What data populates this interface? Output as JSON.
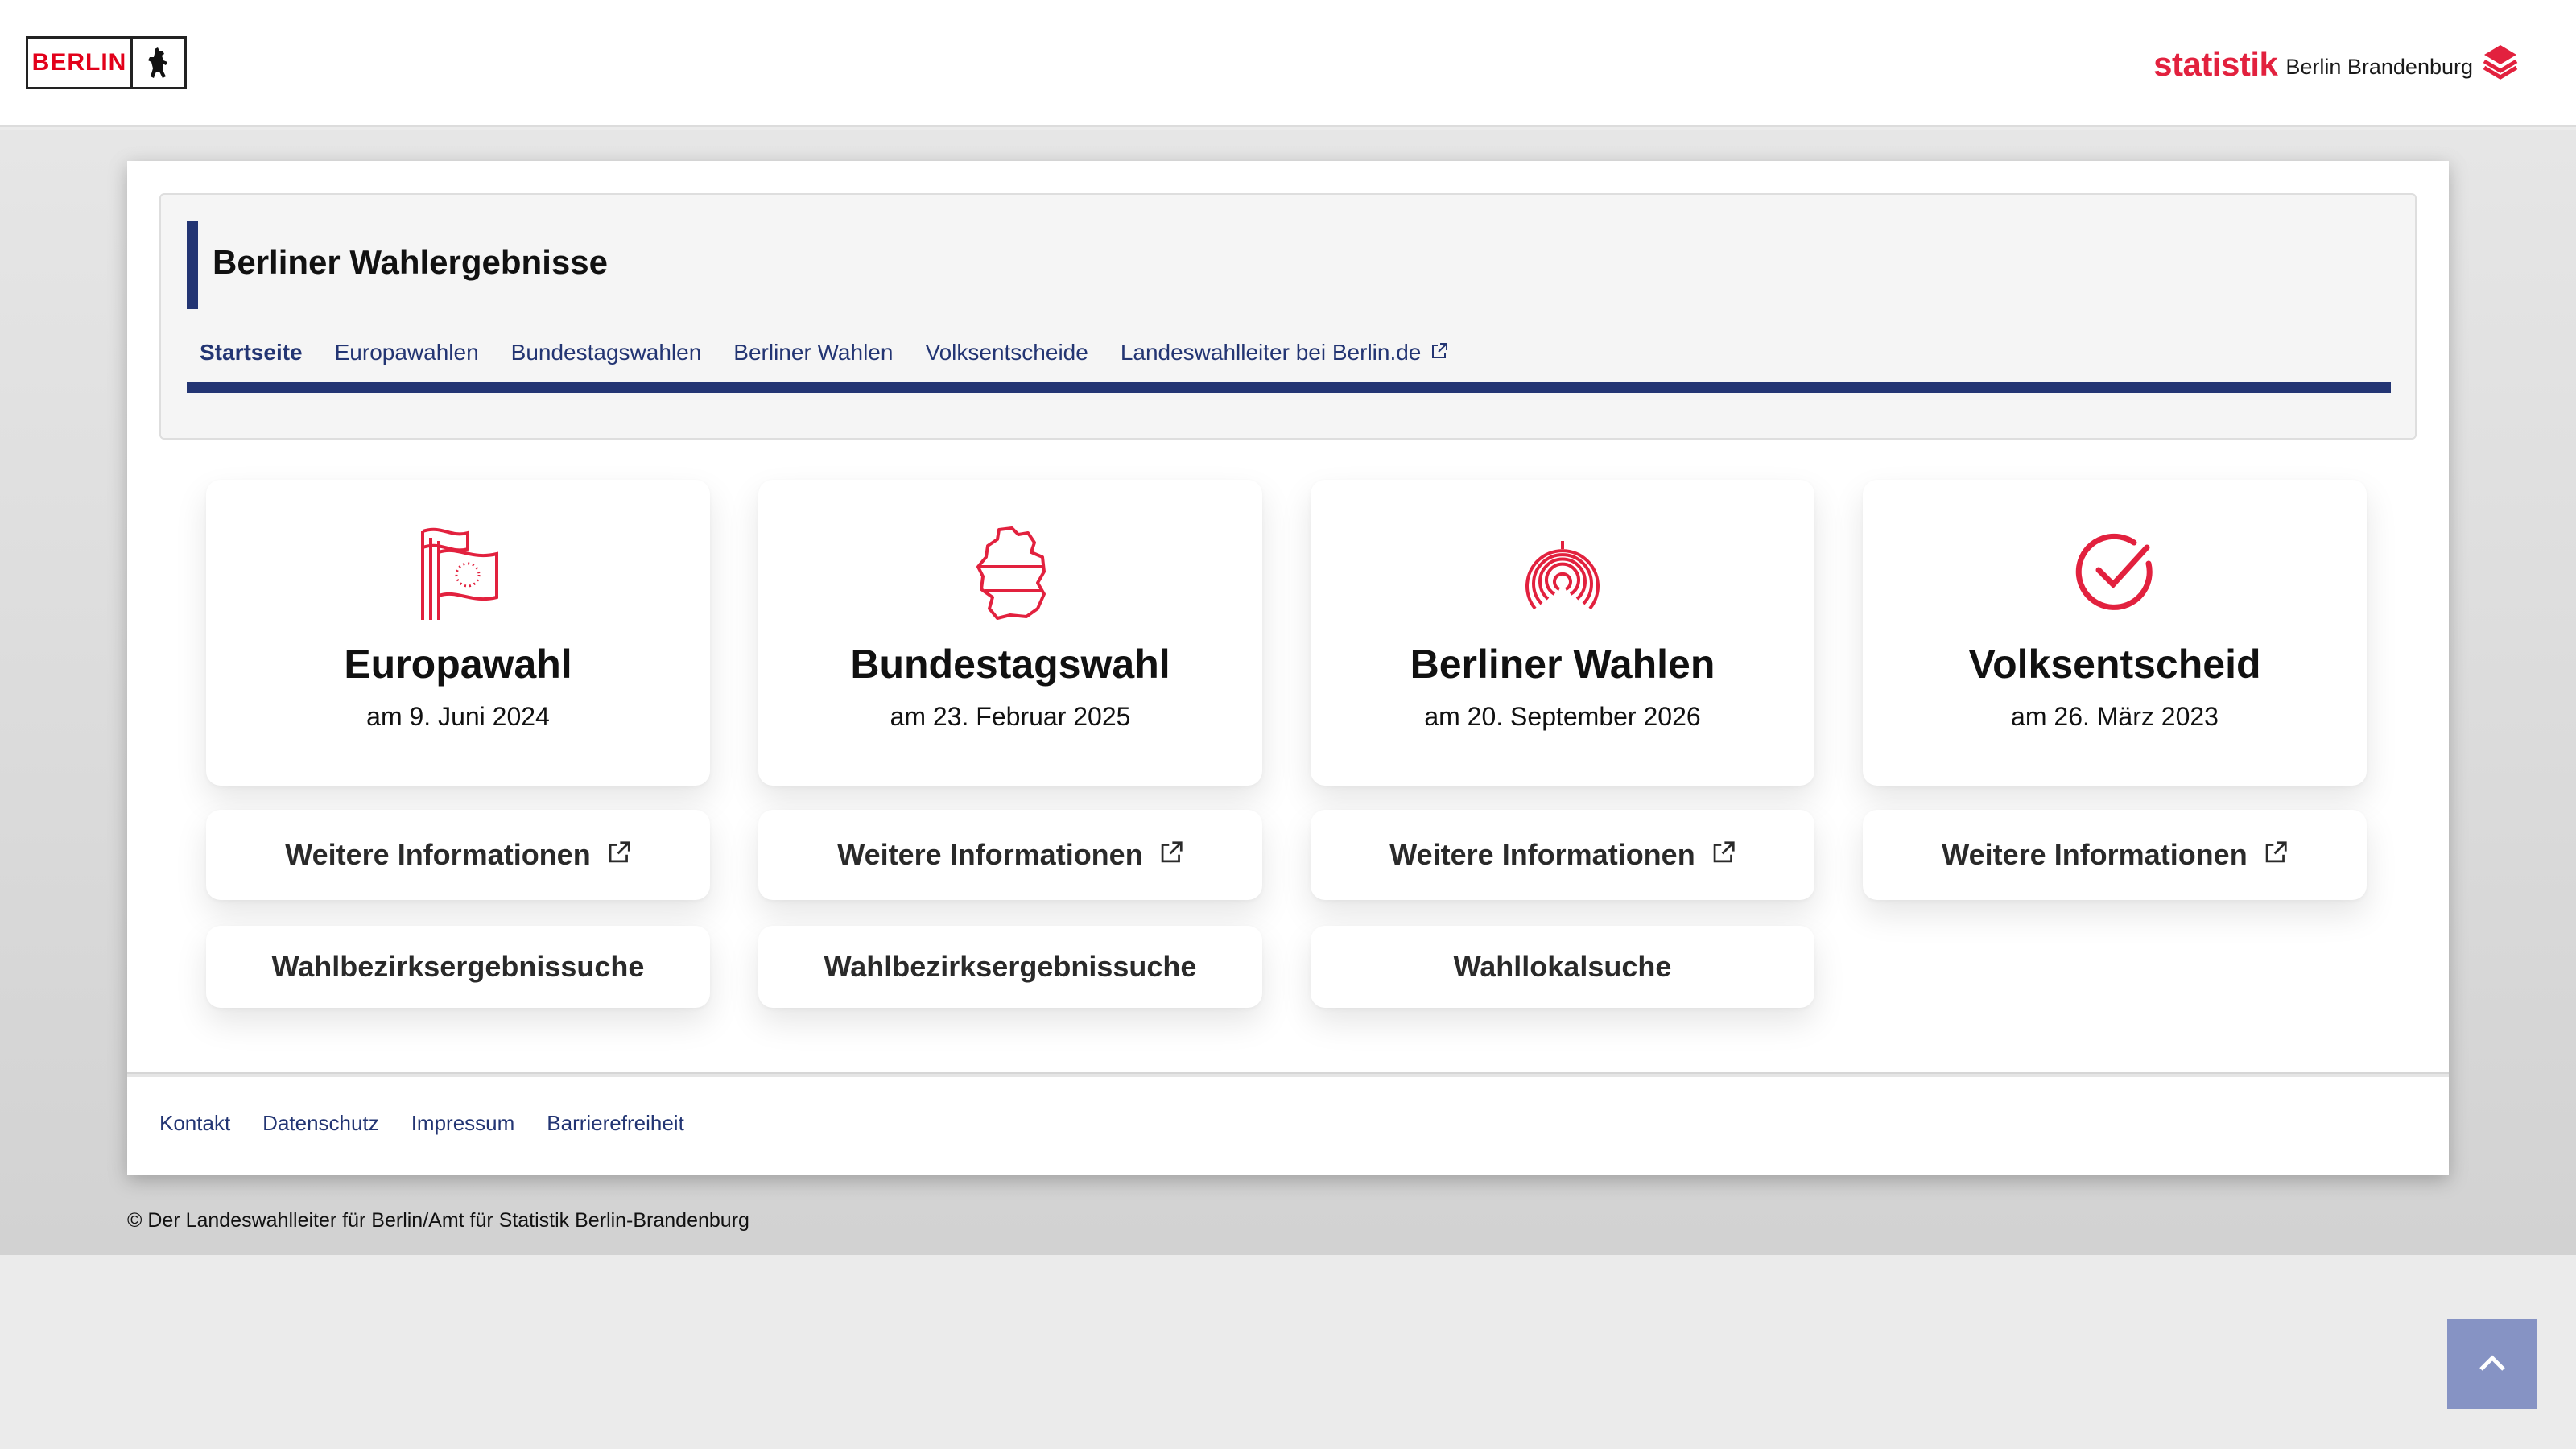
{
  "header": {
    "berlin_logo_text": "BERLIN",
    "statistik_word": "statistik",
    "statistik_region": "Berlin Brandenburg"
  },
  "site": {
    "title": "Berliner Wahlergebnisse",
    "nav": [
      {
        "label": "Startseite",
        "active": true
      },
      {
        "label": "Europawahlen"
      },
      {
        "label": "Bundestagswahlen"
      },
      {
        "label": "Berliner Wahlen"
      },
      {
        "label": "Volksentscheide"
      },
      {
        "label": "Landeswahlleiter bei Berlin.de",
        "icon": "external-link-icon"
      }
    ]
  },
  "cards": [
    {
      "title": "Europawahl",
      "date": "am 9. Juni 2024",
      "icon": "eu-flag-icon",
      "info_label": "Weitere Informationen",
      "search_label": "Wahlbezirksergebnissuche"
    },
    {
      "title": "Bundestagswahl",
      "date": "am 23. Februar 2025",
      "icon": "germany-map-icon",
      "info_label": "Weitere Informationen",
      "search_label": "Wahlbezirksergebnissuche"
    },
    {
      "title": "Berliner Wahlen",
      "date": "am 20. September 2026",
      "icon": "arc-icon",
      "info_label": "Weitere Informationen",
      "search_label": "Wahllokalsuche"
    },
    {
      "title": "Volksentscheid",
      "date": "am 26. März 2023",
      "icon": "check-circle-icon",
      "info_label": "Weitere Informationen"
    }
  ],
  "footer": {
    "links": [
      "Kontakt",
      "Datenschutz",
      "Impressum",
      "Barrierefreiheit"
    ],
    "copyright": "© Der Landeswahlleiter für Berlin/Amt für Statistik Berlin-Brandenburg"
  },
  "colors": {
    "accent_red": "#e2213e",
    "nav_blue": "#233573",
    "to_top_bg": "#8693c4"
  }
}
